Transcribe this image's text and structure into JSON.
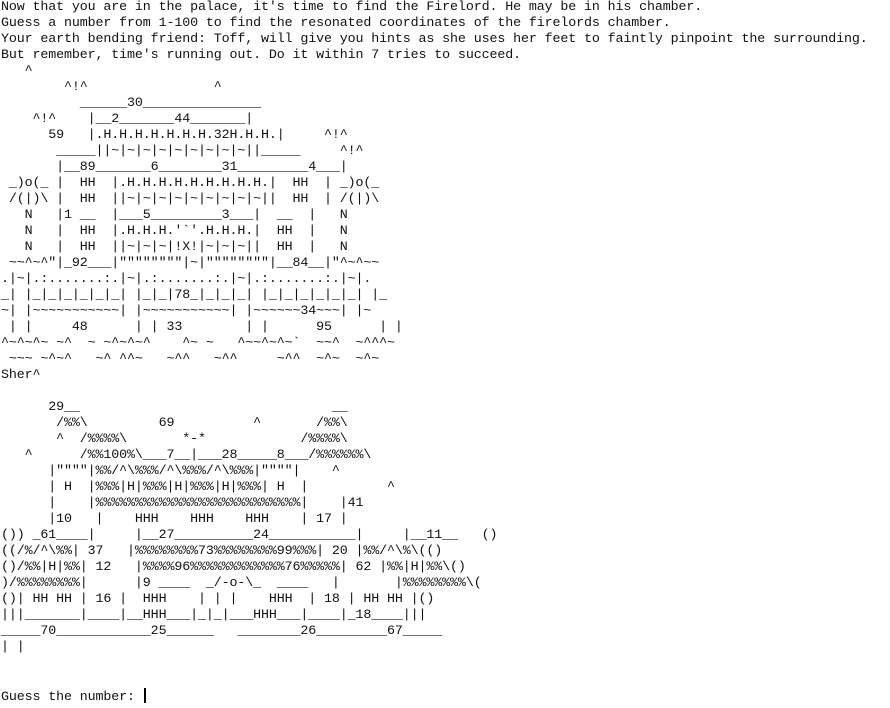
{
  "console": {
    "lines": [
      "Now that you are in the palace, it's time to find the Firelord. He may be in his chamber.",
      "Guess a number from 1-100 to find the resonated coordinates of the firelords chamber.",
      "Your earth bending friend: Toff, will give you hints as she uses her feet to faintly pinpoint the surrounding.",
      "But remember, time's running out. Do it within 7 tries to succeed.",
      "   ^",
      "        ^!^                ^",
      "          ______30_______________",
      "    ^!^    |__2_______44_______|",
      "      59   |.H.H.H.H.H.H.H.32H.H.H.|     ^!^",
      "       _____||~|~|~|~|~|~|~|~|~||_____     ^!^",
      "       |__89_______6________31_________4___|",
      " _)o(_ |  HH  |.H.H.H.H.H.H.H.H.H.|  HH  | _)o(_",
      " /(|)\\ |  HH  ||~|~|~|~|~|~|~|~|~||  HH  | /(|)\\",
      "   N   |1 __  |___5_________3___|  __  |   N",
      "   N   |  HH  |.H.H.H.'`'.H.H.H.|  HH  |   N",
      "   N   |  HH  ||~|~|~|!X!|~|~|~||  HH  |   N",
      " ~~^~^\"|_92___|\"\"\"\"\"\"\"\"|~|\"\"\"\"\"\"\"\"|__84__|\"^~^~~",
      ".|~|.:.......:.|~|.:.......:.|~|.:.......:.|~|.",
      "_| |_|_|_|_|_|_| |_|_|78_|_|_|_| |_|_|_|_|_|_| |_",
      "~| |~~~~~~~~~~~| |~~~~~~~~~~~| |~~~~~~34~~~| |~",
      " | |     48      | | 33        | |      95      | |",
      "^~^~^~ ~^  ~ ~^~^~^    ^~ ~   ^~~^~^~`  ~~^  ~^^^~",
      " ~~~ ~^~^   ~^ ^^~   ~^^   ~^^     ~^^  ~^~  ~^~",
      "Sher^",
      "",
      "      29__                                __",
      "       /%%\\         69          ^       /%%\\",
      "       ^  /%%%%\\       *-*            /%%%%\\",
      "   ^      /%%100%\\___7__|___28_____8___/%%%%%%\\",
      "      |\"\"\"\"|%%/^\\%%%/^\\%%%/^\\%%%|\"\"\"\"|    ^",
      "      | H  |%%%|H|%%%|H|%%%|H|%%%| H  |          ^",
      "      |    |%%%%%%%%%%%%%%%%%%%%%%%%%%|    |41",
      "      |10   |    HHH    HHH    HHH    | 17 |",
      "()) _61____|     |__27__________24___________|     |__11__   ()",
      "((/%/^\\%%| 37   |%%%%%%%%73%%%%%%%%99%%%| 20 |%%/^\\%\\(()",
      "()/%%|H|%%| 12   |%%%%96%%%%%%%%%%%%76%%%%%| 62 |%%|H|%%\\()",
      ")/%%%%%%%%|      |9 ____  _/-o-\\_  ____   |       |%%%%%%%%\\(",
      "()| HH HH | 16 |  HHH    | | |    HHH  | 18 | HH HH |()",
      "|||_______|____|__HHH___|_|_|___HHH___|____|_18____|||",
      "_____70____________25______   ________26_________67_____",
      "| |"
    ]
  },
  "prompt": {
    "label": "Guess the number: ",
    "value": ""
  }
}
